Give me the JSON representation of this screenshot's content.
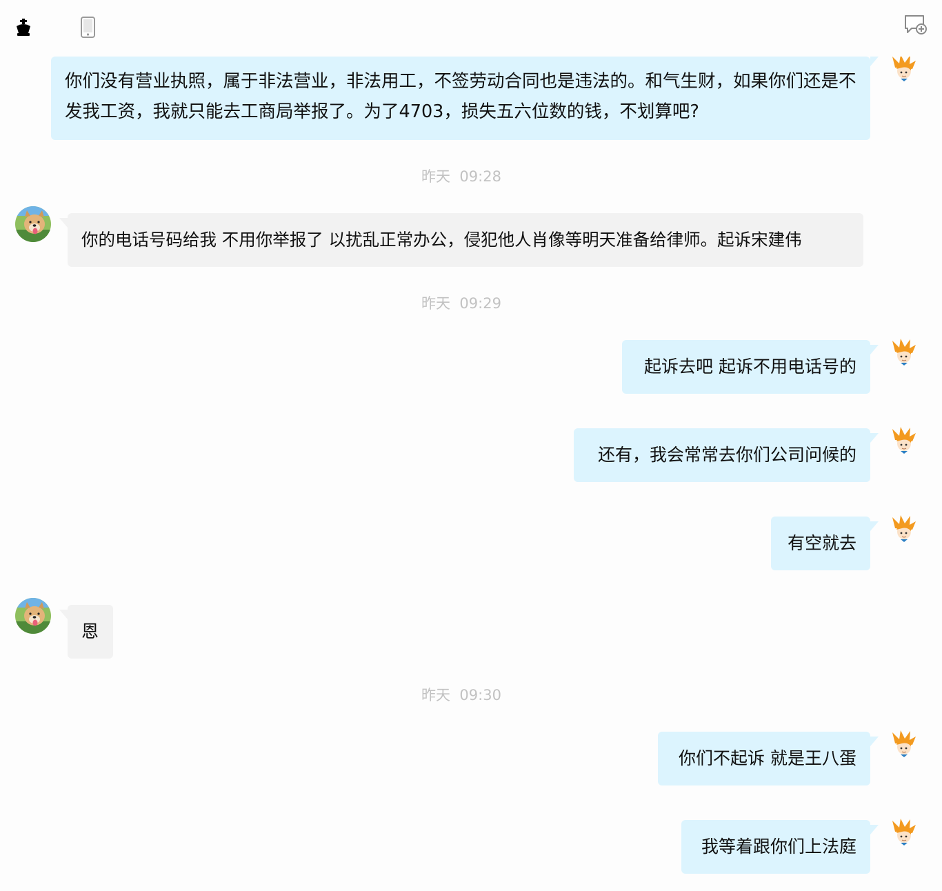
{
  "colors": {
    "outgoing_bubble": "#dcf4fe",
    "incoming_bubble": "#f2f2f2",
    "timestamp_text": "#c2c2c2"
  },
  "toolbar": {
    "left_icons": [
      "chess-king-icon",
      "phone-icon"
    ],
    "right_icon": "new-message-icon"
  },
  "messages": [
    {
      "side": "out",
      "text": "你们没有营业执照，属于非法营业，非法用工，不签劳动合同也是违法的。和气生财，如果你们还是不发我工资，我就只能去工商局举报了。为了4703，损失五六位数的钱，不划算吧?"
    },
    {
      "side": "in",
      "text": "你的电话号码给我  不用你举报了 以扰乱正常办公，侵犯他人肖像等明天准备给律师。起诉宋建伟"
    },
    {
      "side": "out",
      "text": "起诉去吧 起诉不用电话号的"
    },
    {
      "side": "out",
      "text": "还有，我会常常去你们公司问候的"
    },
    {
      "side": "out",
      "text": "有空就去"
    },
    {
      "side": "in",
      "text": "恩"
    },
    {
      "side": "out",
      "text": "你们不起诉 就是王八蛋"
    },
    {
      "side": "out",
      "text": "我等着跟你们上法庭"
    }
  ],
  "timestamps": [
    {
      "day": "昨天",
      "time": "09:28"
    },
    {
      "day": "昨天",
      "time": "09:29"
    },
    {
      "day": "昨天",
      "time": "09:30"
    }
  ]
}
